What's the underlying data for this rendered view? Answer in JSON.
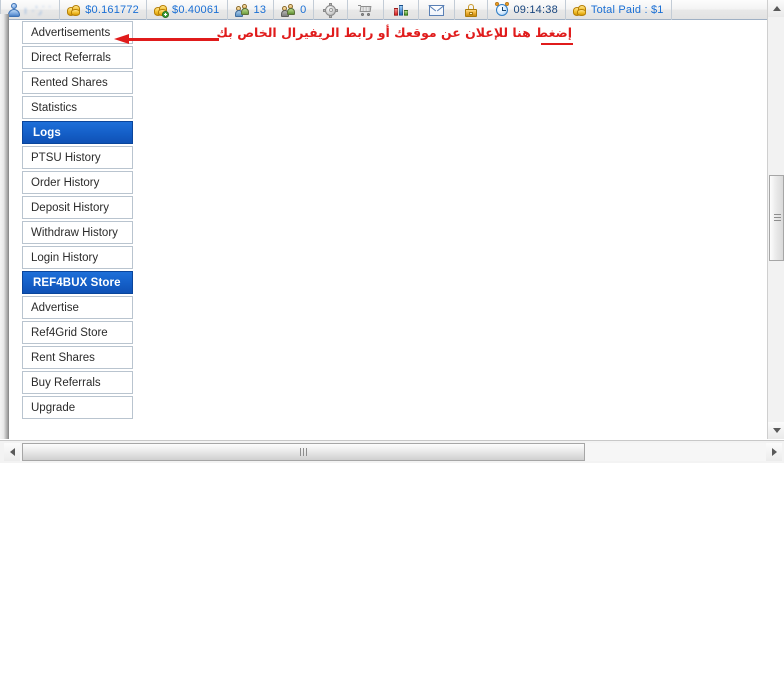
{
  "toolbar": {
    "items": [
      {
        "icon": "user-icon",
        "value": "",
        "blurred": true,
        "type": "user"
      },
      {
        "icon": "coins-icon",
        "value": "$0.161772",
        "blurred": false,
        "type": "coins"
      },
      {
        "icon": "coins-add-icon",
        "value": "$0.40061",
        "blurred": false,
        "type": "coins-add"
      },
      {
        "icon": "referrals-icon",
        "value": "13",
        "blurred": false,
        "type": "people"
      },
      {
        "icon": "rented-referrals-icon",
        "value": "0",
        "blurred": false,
        "type": "people-rented"
      },
      {
        "icon": "gear-icon",
        "value": "",
        "blurred": false,
        "type": "gear"
      },
      {
        "icon": "cart-icon",
        "value": "",
        "blurred": false,
        "type": "cart"
      },
      {
        "icon": "bar-chart-icon",
        "value": "",
        "blurred": false,
        "type": "chart"
      },
      {
        "icon": "envelope-icon",
        "value": "",
        "blurred": false,
        "type": "mail"
      },
      {
        "icon": "padlock-icon",
        "value": "",
        "blurred": false,
        "type": "lock"
      },
      {
        "icon": "alarm-clock-icon",
        "value": "09:14:38",
        "blurred": false,
        "type": "clock"
      },
      {
        "icon": "coins-icon",
        "value": "Total Paid : $1",
        "blurred": false,
        "type": "coins"
      }
    ]
  },
  "sidebar": {
    "items": [
      {
        "label": "Advertisements",
        "type": "link"
      },
      {
        "label": "Direct Referrals",
        "type": "link"
      },
      {
        "label": "Rented Shares",
        "type": "link"
      },
      {
        "label": "Statistics",
        "type": "link"
      },
      {
        "label": "Logs",
        "type": "header"
      },
      {
        "label": "PTSU History",
        "type": "link"
      },
      {
        "label": "Order History",
        "type": "link"
      },
      {
        "label": "Deposit History",
        "type": "link"
      },
      {
        "label": "Withdraw History",
        "type": "link"
      },
      {
        "label": "Login History",
        "type": "link"
      },
      {
        "label": "REF4BUX Store",
        "type": "header"
      },
      {
        "label": "Advertise",
        "type": "link"
      },
      {
        "label": "Ref4Grid Store",
        "type": "link"
      },
      {
        "label": "Rent Shares",
        "type": "link"
      },
      {
        "label": "Buy Referrals",
        "type": "link"
      },
      {
        "label": "Upgrade",
        "type": "link"
      }
    ]
  },
  "annotation": {
    "text": "إضغط هنا للإعلان عن موقعك أو رابط الريفيرال الخاص بك",
    "color": "#e01b1b",
    "arrow_direction": "left",
    "arrow_target": "Advertisements"
  },
  "colors": {
    "header_blue_top": "#1e6fd8",
    "header_blue_bottom": "#0f51b5",
    "toolbar_value_blue": "#1a6fd4",
    "annotation_red": "#e01b1b",
    "menu_border": "#b9c4cf"
  }
}
